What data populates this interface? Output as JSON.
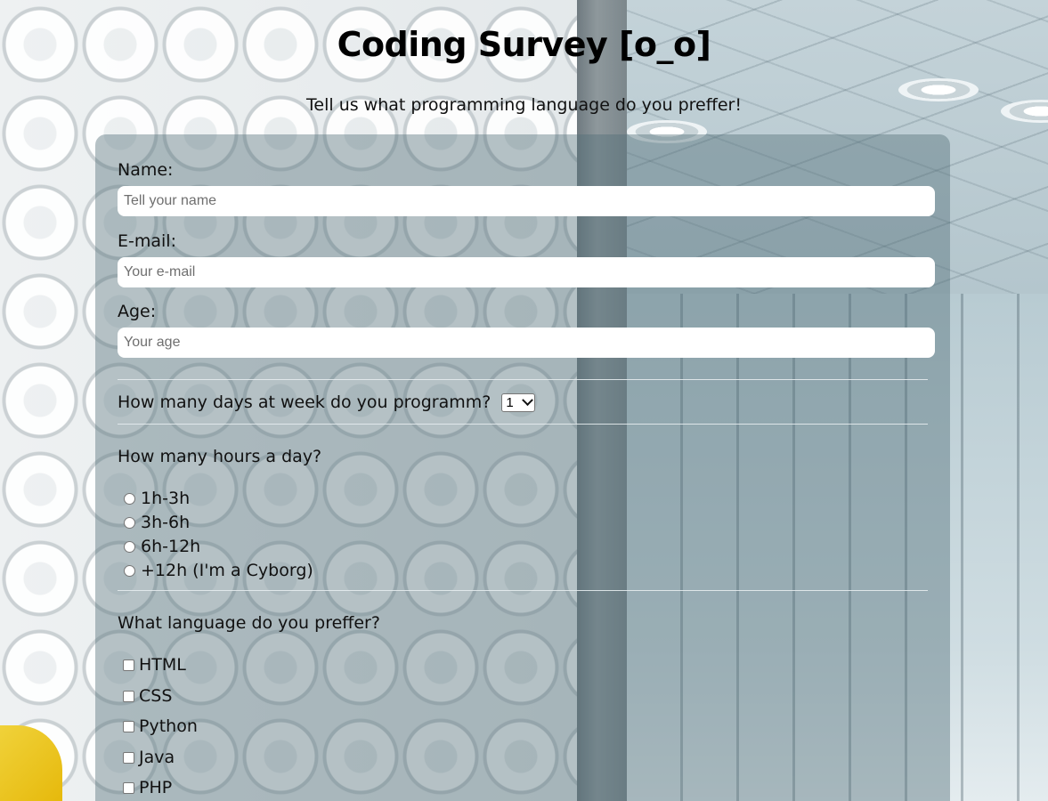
{
  "page": {
    "title": "Coding Survey [o_o]",
    "subtitle": "Tell us what programming language do you preffer!"
  },
  "form": {
    "name": {
      "label": "Name:",
      "placeholder": "Tell your name"
    },
    "email": {
      "label": "E-mail:",
      "placeholder": "Your e-mail"
    },
    "age": {
      "label": "Age:",
      "placeholder": "Your age"
    },
    "days": {
      "label": "How many days at week do you programm?",
      "selected": "1"
    },
    "hours": {
      "label": "How many hours a day?",
      "options": [
        "1h-3h",
        "3h-6h",
        "6h-12h",
        "+12h (I'm a Cyborg)"
      ]
    },
    "languages": {
      "label": "What language do you preffer?",
      "options": [
        "HTML",
        "CSS",
        "Python",
        "Java",
        "PHP"
      ]
    }
  }
}
